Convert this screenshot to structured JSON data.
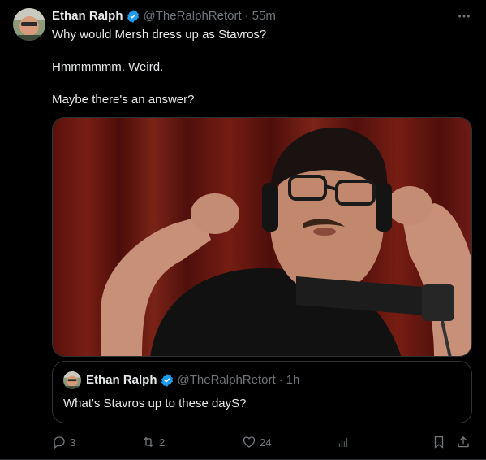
{
  "tweet": {
    "author": {
      "name": "Ethan Ralph",
      "handle": "@TheRalphRetort",
      "separator": "·",
      "time": "55m"
    },
    "lines": [
      "Why would Mersh dress up as Stavros?",
      "Hmmmmmm. Weird.",
      "Maybe there's an answer?"
    ],
    "quoted": {
      "author_name": "Ethan Ralph",
      "handle": "@TheRalphRetort",
      "separator": "·",
      "time": "1h",
      "text": "What's Stavros up to these dayS?"
    },
    "stats": {
      "replies": "3",
      "reposts": "2",
      "likes": "24"
    }
  },
  "icons": {
    "verified": "verified-badge-icon",
    "more": "more-horizontal-icon",
    "reply": "reply-icon",
    "repost": "repost-icon",
    "like": "heart-icon",
    "views": "analytics-icon",
    "bookmark": "bookmark-icon",
    "share": "share-icon"
  },
  "colors": {
    "background": "#000000",
    "text": "#e7e9ea",
    "muted": "#71767b",
    "border": "#2f3336",
    "verified": "#1d9bf0"
  }
}
